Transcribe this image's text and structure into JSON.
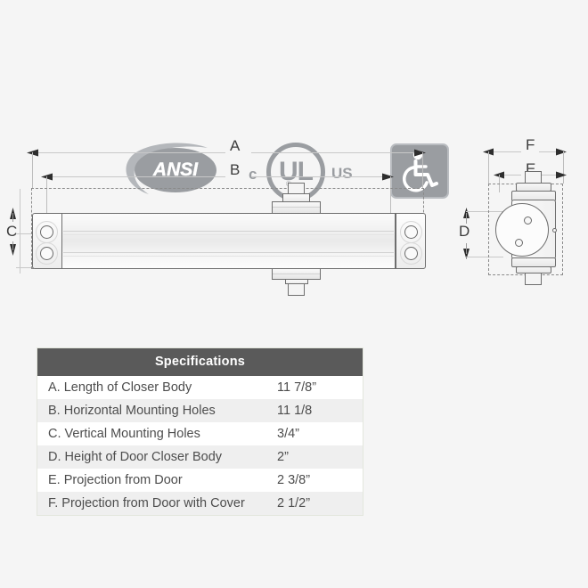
{
  "background_color": "#f5f5f5",
  "certifications": [
    {
      "name": "ansi-logo",
      "label": "ANSI",
      "color": "#9a9da1"
    },
    {
      "name": "ul-listed-logo",
      "prefix": "c",
      "mark": "UL",
      "registered": "®",
      "suffix": "US",
      "color": "#9a9da1"
    },
    {
      "name": "ada-accessibility-logo",
      "label": "wheelchair-accessible",
      "color": "#9a9da1"
    }
  ],
  "diagram": {
    "side_view": {
      "name": "door-closer-side-view",
      "dimension_labels": [
        {
          "id": "A",
          "label": "A",
          "orientation": "horizontal",
          "measures": "overall length of closer body"
        },
        {
          "id": "B",
          "label": "B",
          "orientation": "horizontal",
          "measures": "horizontal mounting hole spacing"
        },
        {
          "id": "C",
          "label": "C",
          "orientation": "vertical",
          "measures": "vertical mounting hole spacing"
        }
      ]
    },
    "end_view": {
      "name": "door-closer-end-view",
      "dimension_labels": [
        {
          "id": "D",
          "label": "D",
          "orientation": "vertical",
          "measures": "height of door closer body"
        },
        {
          "id": "E",
          "label": "E",
          "orientation": "horizontal",
          "measures": "projection from door"
        },
        {
          "id": "F",
          "label": "F",
          "orientation": "horizontal",
          "measures": "projection from door with cover"
        }
      ]
    }
  },
  "table": {
    "title": "Specifications",
    "header_color": "#5a5a5a",
    "rows": [
      {
        "name": "A. Length of Closer Body",
        "value": "11 7/8”"
      },
      {
        "name": "B. Horizontal Mounting Holes",
        "value": "11  1/8"
      },
      {
        "name": "C. Vertical Mounting Holes",
        "value": "3/4”"
      },
      {
        "name": "D. Height of Door Closer Body",
        "value": "2”"
      },
      {
        "name": "E. Projection from Door",
        "value": "2 3/8”"
      },
      {
        "name": "F. Projection from Door with Cover",
        "value": "2 1/2”"
      }
    ]
  }
}
